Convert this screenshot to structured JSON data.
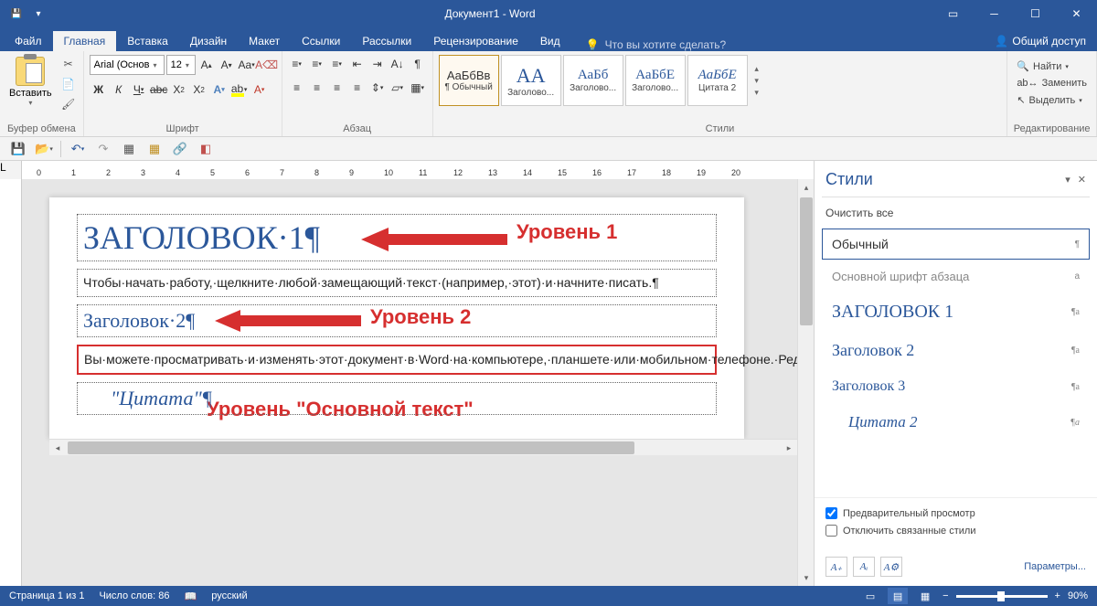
{
  "window": {
    "title": "Документ1 - Word"
  },
  "tabs": [
    "Файл",
    "Главная",
    "Вставка",
    "Дизайн",
    "Макет",
    "Ссылки",
    "Рассылки",
    "Рецензирование",
    "Вид"
  ],
  "active_tab": "Главная",
  "tell_me": "Что вы хотите сделать?",
  "share": "Общий доступ",
  "ribbon": {
    "clipboard": {
      "label": "Буфер обмена",
      "paste": "Вставить"
    },
    "font": {
      "label": "Шрифт",
      "name": "Arial (Основ",
      "size": "12"
    },
    "paragraph": {
      "label": "Абзац"
    },
    "styles": {
      "label": "Стили",
      "items": [
        {
          "preview": "АаБбВв",
          "name": "¶ Обычный",
          "cls": "sp-normal",
          "selected": true
        },
        {
          "preview": "АА",
          "name": "Заголово...",
          "cls": "sp-h1"
        },
        {
          "preview": "АаБб",
          "name": "Заголово...",
          "cls": "sp-h2p"
        },
        {
          "preview": "АаБбЕ",
          "name": "Заголово...",
          "cls": "sp-h2p"
        },
        {
          "preview": "АаБбЕ",
          "name": "Цитата 2",
          "cls": "sp-quote"
        }
      ]
    },
    "editing": {
      "label": "Редактирование",
      "find": "Найти",
      "replace": "Заменить",
      "select": "Выделить"
    }
  },
  "styles_pane": {
    "title": "Стили",
    "clear": "Очистить все",
    "items": [
      {
        "label": "Обычный",
        "cls": "normal sel",
        "marker": "¶"
      },
      {
        "label": "Основной шрифт абзаца",
        "cls": "bpf",
        "marker": "a"
      },
      {
        "label": "ЗАГОЛОВОК 1",
        "cls": "h1s",
        "marker": "¶a"
      },
      {
        "label": "Заголовок 2",
        "cls": "h2s",
        "marker": "¶a"
      },
      {
        "label": "Заголовок 3",
        "cls": "h3s",
        "marker": "¶a"
      },
      {
        "label": "Цитата 2",
        "cls": "q2",
        "marker": "¶a"
      }
    ],
    "preview_check": "Предварительный просмотр",
    "disable_linked": "Отключить связанные стили",
    "options": "Параметры..."
  },
  "document": {
    "h1": "ЗАГОЛОВОК·1¶",
    "p1": "Чтобы·начать·работу,·щелкните·любой·замещающий·текст·(например,·этот)·и·начните·писать.¶",
    "h2": "Заголовок·2¶",
    "p2": "Вы·можете·просматривать·и·изменять·этот·документ·в·Word·на·компьютере,·планшете·или·мобильном·телефоне.·Редактируйте·текст,·вставляйте·содержимое,·например·рисунки,·фигуры·и·таблицы,·и·сохраняйте·документ·в·облаке·с·помощью·приложения·Word·на·компьютерах·Mac·и·устройствах·с·Windows,·Android·и·iOS.¶",
    "quote": "\"Цитата\"¶"
  },
  "annotations": {
    "level1": "Уровень 1",
    "level2": "Уровень 2",
    "body_level": "Уровень \"Основной текст\""
  },
  "statusbar": {
    "page": "Страница 1 из 1",
    "words": "Число слов: 86",
    "lang": "русский",
    "zoom": "90%"
  }
}
